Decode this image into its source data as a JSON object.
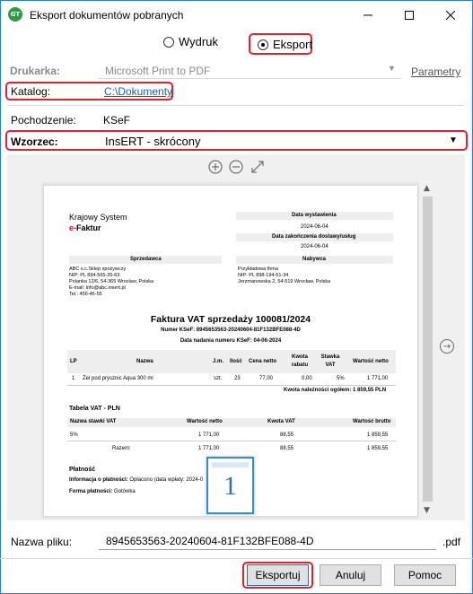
{
  "window": {
    "title": "Eksport dokumentów pobranych",
    "app_icon_text": "GT"
  },
  "mode": {
    "print_label": "Wydruk",
    "export_label": "Eksport",
    "selected": "export"
  },
  "printer": {
    "label": "Drukarka:",
    "value": "Microsoft Print to PDF",
    "settings_link": "Parametry"
  },
  "catalog": {
    "label": "Katalog:",
    "value": "C:\\Dokumenty"
  },
  "origin": {
    "label": "Pochodzenie:",
    "value": "KSeF"
  },
  "template": {
    "label": "Wzorzec:",
    "value": "InsERT - skrócony"
  },
  "document": {
    "brand_line1": "Krajowy System",
    "brand_prefix": "e-",
    "brand_suffix": "Faktur",
    "issue_date_label": "Data wystawienia",
    "issue_date": "2024-06-04",
    "delivery_date_label": "Data zakończenia dostawy/usług",
    "delivery_date": "2024-06-04",
    "seller_label": "Sprzedawca",
    "seller_lines": [
      "ABC s.c.Sklep spożywczy",
      "NIP: PL 894-565-35-63",
      "Polanka 12/6, 54-365 Wrocław, Polska",
      "E-mail: info@abc.insert.pl",
      "Tel.: 456-46-55"
    ],
    "buyer_label": "Nabywca",
    "buyer_lines": [
      "Przykładowa firma",
      "NIP: PL 898-194-51-34",
      "Jerzmanowska 2, 54-519 Wrocław, Polska"
    ],
    "invoice_title": "Faktura VAT sprzedaży 100081/2024",
    "ksef_number": "Numer KSeF: 8945653563-20240604-81F132BFE088-4D",
    "ksef_date": "Data nadania numeru KSeF: 04-06-2024",
    "items_headers": [
      "LP",
      "Nazwa",
      "J.m.",
      "Ilość",
      "Cena netto",
      "Kwota rabatu",
      "Stawka VAT",
      "Wartość netto"
    ],
    "items": [
      [
        "1",
        "Żel pod prysznic Aqua 300 ml",
        "szt.",
        "23",
        "77,00",
        "0,00",
        "5%",
        "1 771,00"
      ]
    ],
    "total_due": "Kwota należności ogółem: 1 859,55 PLN",
    "vat_table_title": "Tabela VAT - PLN",
    "vat_headers": [
      "Nazwa stawki VAT",
      "Wartość netto",
      "Kwota VAT",
      "Wartość brutto"
    ],
    "vat_rows": [
      [
        "5%",
        "1 771,00",
        "88,55",
        "1 859,55"
      ],
      [
        "Razem:",
        "1 771,00",
        "88,55",
        "1 859,55"
      ]
    ],
    "payment_title": "Płatność",
    "payment_info_label": "Informacja o płatności:",
    "payment_info_value": "Opłacono (data wpłaty: 2024-0",
    "payment_form_label": "Forma płatności:",
    "payment_form_value": "Gotówka",
    "page_badge": "1"
  },
  "filename": {
    "label": "Nazwa pliku:",
    "value": "8945653563-20240604-81F132BFE088-4D",
    "extension": ".pdf"
  },
  "buttons": {
    "export": "Eksportuj",
    "cancel": "Anuluj",
    "help": "Pomoc"
  },
  "colors": {
    "highlight": "#e0202a",
    "brand_red": "#c8102e",
    "link": "#1a5fb4"
  }
}
